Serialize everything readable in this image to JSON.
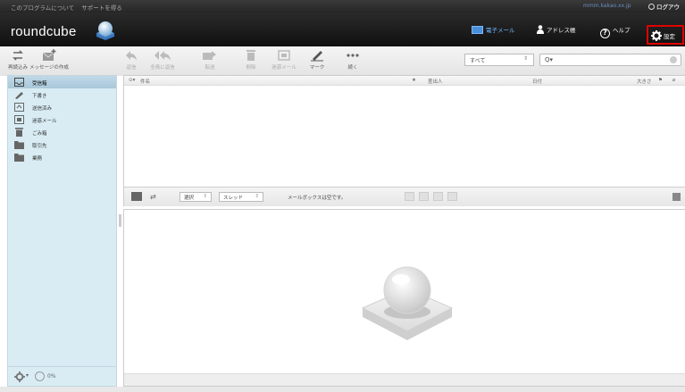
{
  "topline": {
    "about": "このプログラムについて",
    "support": "サポートを得る",
    "user": "mmm.kakao.xx.jp",
    "logout": "ログアウト"
  },
  "header": {
    "logo": "roundcube"
  },
  "taskbar": {
    "mail": "電子メール",
    "addressbook": "アドレス帳",
    "help": "ヘルプ",
    "settings": "設定"
  },
  "toolbar": {
    "refresh": "再読込み",
    "compose": "メッセージの作成",
    "reply": "返信",
    "reply_all": "全員に返信",
    "forward": "転送",
    "delete": "削除",
    "archive": "迷惑メール",
    "mark": "マーク",
    "more": "続く"
  },
  "search": {
    "filter": "すべて",
    "placeholder": "Q▾"
  },
  "folders": [
    {
      "label": "受信箱",
      "icon": "inbox-icon",
      "selected": true
    },
    {
      "label": "下書き",
      "icon": "pencil-icon"
    },
    {
      "label": "送信済み",
      "icon": "sent-icon"
    },
    {
      "label": "迷惑メール",
      "icon": "junk-icon"
    },
    {
      "label": "ごみ箱",
      "icon": "trash-icon"
    },
    {
      "label": "取引先",
      "icon": "folder-icon"
    },
    {
      "label": "業務",
      "icon": "folder-icon"
    }
  ],
  "folder_footer": {
    "quota": "0%"
  },
  "msglist": {
    "col_subject": "件名",
    "col_from": "差出人",
    "col_date": "日付",
    "col_size": "大きさ"
  },
  "msglist_footer": {
    "select": "選択",
    "threads": "スレッド",
    "status": "メールボックスは空です。"
  }
}
